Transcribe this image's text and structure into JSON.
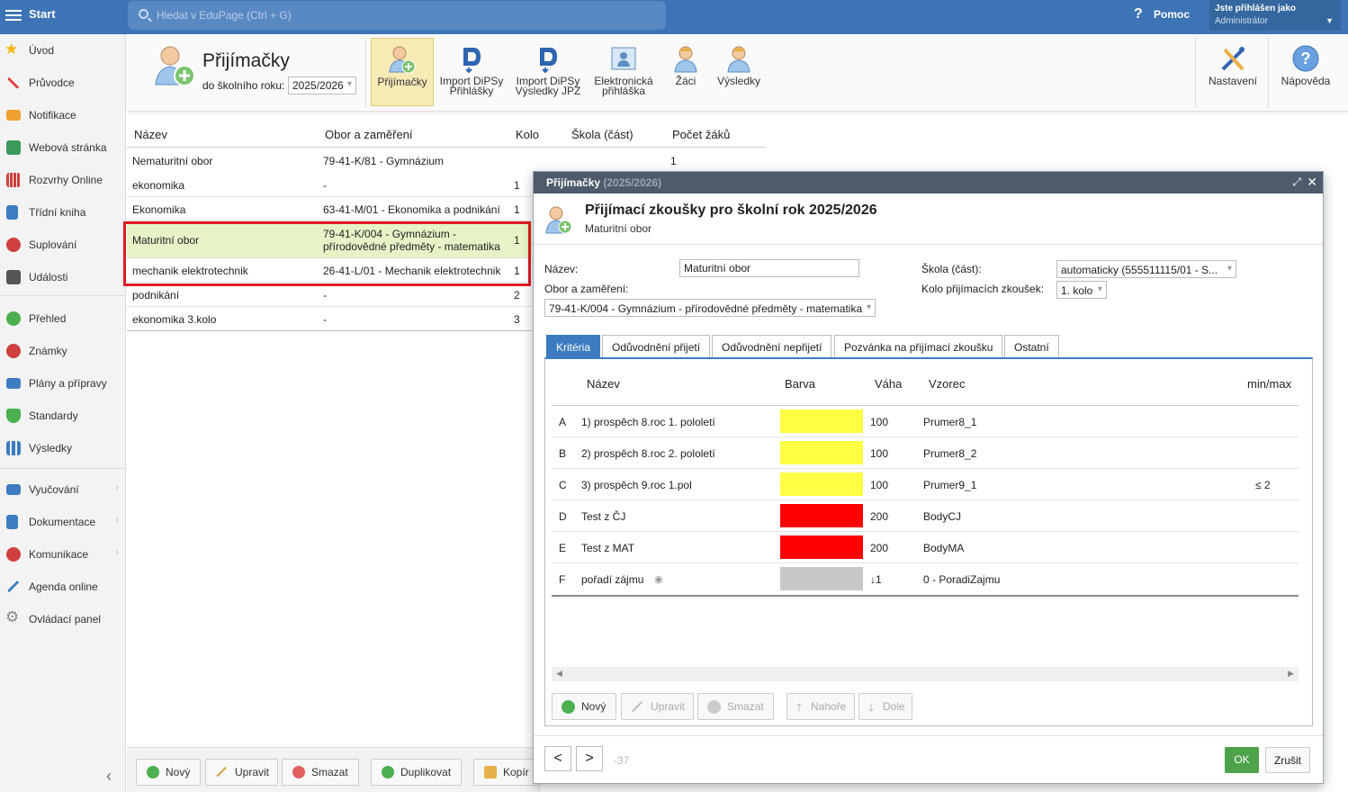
{
  "topbar": {
    "start_label": "Start",
    "search_placeholder": "Hledat v EduPage (Ctrl + G)",
    "help_label": "Pomoc",
    "user_line1": "Jste přihlášen jako",
    "user_line2": "Administrátor"
  },
  "sidebar": {
    "items": [
      {
        "label": "Úvod",
        "icon": "star-icon",
        "color": "#f5b700"
      },
      {
        "label": "Průvodce",
        "icon": "wand-icon",
        "color": "#e0403a"
      },
      {
        "label": "Notifikace",
        "icon": "envelope-icon",
        "color": "#f0a030"
      },
      {
        "label": "Webová stránka",
        "icon": "house-icon",
        "color": "#3a9a5a"
      },
      {
        "label": "Rozvrhy Online",
        "icon": "calendar-grid-icon",
        "color": "#d04040"
      },
      {
        "label": "Třídní kniha",
        "icon": "book-icon",
        "color": "#3d7cc0"
      },
      {
        "label": "Suplování",
        "icon": "person-icon",
        "color": "#d04040"
      },
      {
        "label": "Události",
        "icon": "calendar-icon",
        "color": "#555555"
      },
      {
        "label": "Přehled",
        "icon": "check-circle-icon",
        "color": "#4caf50"
      },
      {
        "label": "Známky",
        "icon": "grades-icon",
        "color": "#d04040"
      },
      {
        "label": "Plány a přípravy",
        "icon": "briefcase-icon",
        "color": "#3d7cc0"
      },
      {
        "label": "Standardy",
        "icon": "shield-icon",
        "color": "#4caf50"
      },
      {
        "label": "Výsledky",
        "icon": "bar-chart-icon",
        "color": "#3d7cc0"
      },
      {
        "label": "Vyučování",
        "icon": "book-open-icon",
        "color": "#3d7cc0"
      },
      {
        "label": "Dokumentace",
        "icon": "document-icon",
        "color": "#3d7cc0"
      },
      {
        "label": "Komunikace",
        "icon": "chat-icon",
        "color": "#d04040"
      },
      {
        "label": "Agenda online",
        "icon": "pen-icon",
        "color": "#3d7cc0"
      },
      {
        "label": "Ovládací panel",
        "icon": "gear-icon",
        "color": "#888888"
      }
    ]
  },
  "toolbar": {
    "title": "Přijímačky",
    "year_label": "do školního roku:",
    "year_value": "2025/2026",
    "buttons": [
      {
        "label": "Přijímačky",
        "icon": "user-add-icon"
      },
      {
        "label1": "Import DiPSy",
        "label2": "Přihlášky",
        "icon": "import-d-icon"
      },
      {
        "label1": "Import DiPSy",
        "label2": "Výsledky JPZ",
        "icon": "import-d-icon"
      },
      {
        "label1": "Elektronická",
        "label2": "přihláška",
        "icon": "id-card-icon"
      },
      {
        "label": "Žáci",
        "icon": "student-icon"
      },
      {
        "label": "Výsledky",
        "icon": "student-icon"
      },
      {
        "label": "Nastavení",
        "icon": "tools-icon"
      },
      {
        "label": "Nápověda",
        "icon": "help-circle-icon"
      }
    ]
  },
  "table": {
    "headers": [
      "Název",
      "Obor a zaměření",
      "Kolo",
      "Škola (část)",
      "Počet žáků"
    ],
    "rows": [
      {
        "name": "Nematuritní obor",
        "field": "79-41-K/81 - Gymnázium",
        "round": "",
        "count": "1"
      },
      {
        "name": "ekonomika",
        "field": "-",
        "round": "1",
        "count": ""
      },
      {
        "name": "Ekonomika",
        "field": "63-41-M/01 - Ekonomika a podnikání",
        "round": "1",
        "count": ""
      },
      {
        "name": "Maturitní obor",
        "field1": "79-41-K/004 - Gymnázium -",
        "field2": "přírodovědné předměty - matematika",
        "round": "1",
        "count": ""
      },
      {
        "name": "mechanik elektrotechnik",
        "field": "26-41-L/01 - Mechanik elektrotechnik",
        "round": "1",
        "count": ""
      },
      {
        "name": "podnikání",
        "field": "-",
        "round": "2",
        "count": ""
      },
      {
        "name": "ekonomika 3.kolo",
        "field": "-",
        "round": "3",
        "count": ""
      }
    ]
  },
  "bottom_bar": {
    "buttons": [
      "Nový",
      "Upravit",
      "Smazat",
      "Duplikovat",
      "Kopír"
    ]
  },
  "modal": {
    "title": "Přijímačky",
    "title_year": "(2025/2026)",
    "heading": "Přijímací zkoušky pro školní rok 2025/2026",
    "subheading": "Maturitní obor",
    "form": {
      "name_label": "Název:",
      "name_value": "Maturitní obor",
      "field_label": "Obor a zaměření:",
      "field_value": "79-41-K/004 - Gymnázium - přírodovědné předměty - matematika",
      "school_label": "Škola (část):",
      "school_value": "automaticky (555511115/01 - S...",
      "round_label": "Kolo přijímacích zkoušek:",
      "round_value": "1. kolo"
    },
    "tabs": [
      "Kritéria",
      "Odůvodnění přijetí",
      "Odůvodnění nepřijetí",
      "Pozvánka na přijímací zkoušku",
      "Ostatní"
    ],
    "criteria": {
      "headers": [
        "Název",
        "Barva",
        "Váha",
        "Vzorec",
        "min/max"
      ],
      "rows": [
        {
          "letter": "A",
          "name": "1) prospěch 8.roc 1. pololetí",
          "color": "#ffff44",
          "weight": "100",
          "formula": "Prumer8_1",
          "minmax": ""
        },
        {
          "letter": "B",
          "name": "2) prospěch 8.roc 2. pololetí",
          "color": "#ffff44",
          "weight": "100",
          "formula": "Prumer8_2",
          "minmax": ""
        },
        {
          "letter": "C",
          "name": "3) prospěch 9.roc 1.pol",
          "color": "#ffff44",
          "weight": "100",
          "formula": "Prumer9_1",
          "minmax": "≤ 2"
        },
        {
          "letter": "D",
          "name": "Test z ČJ",
          "color": "#ff0000",
          "weight": "200",
          "formula": "BodyCJ",
          "minmax": ""
        },
        {
          "letter": "E",
          "name": "Test z MAT",
          "color": "#ff0000",
          "weight": "200",
          "formula": "BodyMA",
          "minmax": ""
        },
        {
          "letter": "F",
          "name": "pořadí zájmu",
          "color": "#c8c8c8",
          "weight": "↓1",
          "formula": "0 - PoradiZajmu",
          "minmax": ""
        }
      ],
      "buttons": [
        "Nový",
        "Upravit",
        "Smazat",
        "Nahoře",
        "Dole"
      ]
    },
    "footer": {
      "prev": "<",
      "next": ">",
      "record_id": "-37",
      "ok": "OK",
      "cancel": "Zrušit"
    }
  }
}
